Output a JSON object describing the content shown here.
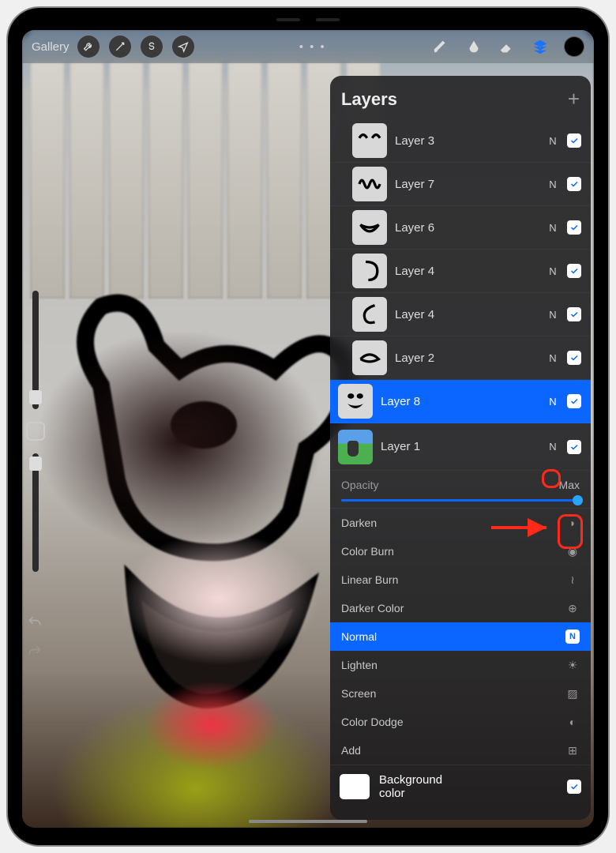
{
  "toolbar": {
    "gallery_label": "Gallery",
    "more_dots": "• • •"
  },
  "panel": {
    "title": "Layers",
    "opacity_label": "Opacity",
    "opacity_value": "Max",
    "bg_label": "Background color"
  },
  "layers": [
    {
      "name": "Layer 3",
      "badge": "N",
      "checked": true,
      "selected": false,
      "indent": true,
      "thumb": "arcs"
    },
    {
      "name": "Layer 7",
      "badge": "N",
      "checked": true,
      "selected": false,
      "indent": true,
      "thumb": "scribble"
    },
    {
      "name": "Layer 6",
      "badge": "N",
      "checked": true,
      "selected": false,
      "indent": true,
      "thumb": "smile"
    },
    {
      "name": "Layer 4",
      "badge": "N",
      "checked": true,
      "selected": false,
      "indent": true,
      "thumb": "hook"
    },
    {
      "name": "Layer 4",
      "badge": "N",
      "checked": true,
      "selected": false,
      "indent": true,
      "thumb": "curve"
    },
    {
      "name": "Layer 2",
      "badge": "N",
      "checked": true,
      "selected": false,
      "indent": true,
      "thumb": "oval"
    },
    {
      "name": "Layer 8",
      "badge": "N",
      "checked": true,
      "selected": true,
      "indent": false,
      "thumb": "face"
    },
    {
      "name": "Layer 1",
      "badge": "N",
      "checked": true,
      "selected": false,
      "indent": false,
      "thumb": "photo"
    }
  ],
  "blend_modes": [
    {
      "name": "Darken",
      "icon": "moon",
      "selected": false
    },
    {
      "name": "Color Burn",
      "icon": "drop",
      "selected": false
    },
    {
      "name": "Linear Burn",
      "icon": "flame",
      "selected": false
    },
    {
      "name": "Darker Color",
      "icon": "plus",
      "selected": false
    },
    {
      "name": "Normal",
      "icon": "N",
      "selected": true
    },
    {
      "name": "Lighten",
      "icon": "sun",
      "selected": false
    },
    {
      "name": "Screen",
      "icon": "hatch",
      "selected": false
    },
    {
      "name": "Color Dodge",
      "icon": "lens",
      "selected": false
    },
    {
      "name": "Add",
      "icon": "plusbox",
      "selected": false
    }
  ]
}
